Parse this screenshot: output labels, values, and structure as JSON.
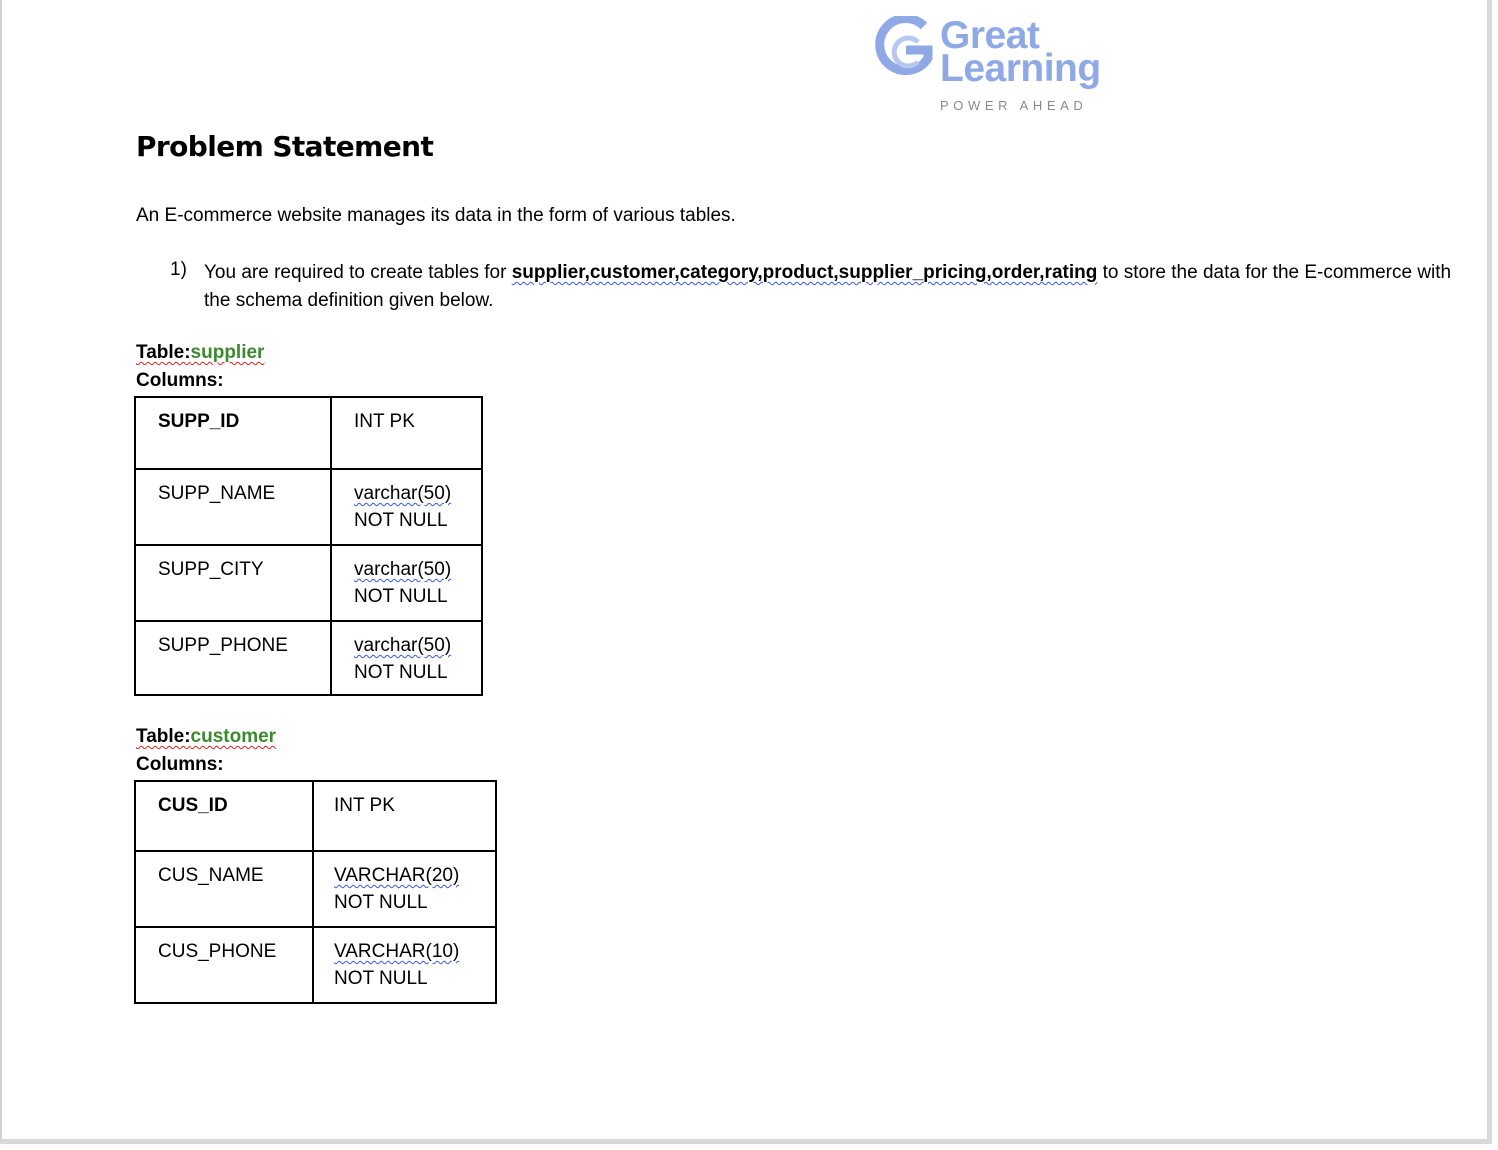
{
  "logo": {
    "line1": "Great",
    "line2": "Learning",
    "tagline": "POWER AHEAD",
    "color": "#8ea9e6"
  },
  "title": "Problem Statement",
  "intro": "An E-commerce website manages its data in the form of various tables.",
  "item": {
    "number": "1)",
    "prefix": "You are required to create tables for ",
    "tables_list": "supplier,customer,category,product,supplier_pricing,order,rating",
    "suffix": " to store the data for the E-commerce with the schema definition given below."
  },
  "tables": [
    {
      "label_prefix": "Table:",
      "name": "supplier",
      "columns_label": "Columns:",
      "rows": [
        {
          "column": "SUPP_ID",
          "type": "INT PK",
          "constraint": ""
        },
        {
          "column": "SUPP_NAME",
          "type": "varchar(50)",
          "constraint": "NOT NULL"
        },
        {
          "column": "SUPP_CITY",
          "type": "varchar(50)",
          "constraint": "NOT NULL"
        },
        {
          "column": "SUPP_PHONE",
          "type": "varchar(50)",
          "constraint": "NOT NULL"
        }
      ]
    },
    {
      "label_prefix": "Table:",
      "name": "customer",
      "columns_label": "Columns:",
      "rows": [
        {
          "column": "CUS_ID",
          "type": "INT PK",
          "constraint": ""
        },
        {
          "column": "CUS_NAME",
          "type": "VARCHAR(20)",
          "constraint": "NOT NULL"
        },
        {
          "column": "CUS_PHONE",
          "type": "VARCHAR(10)",
          "constraint": "NOT NULL"
        }
      ]
    }
  ]
}
